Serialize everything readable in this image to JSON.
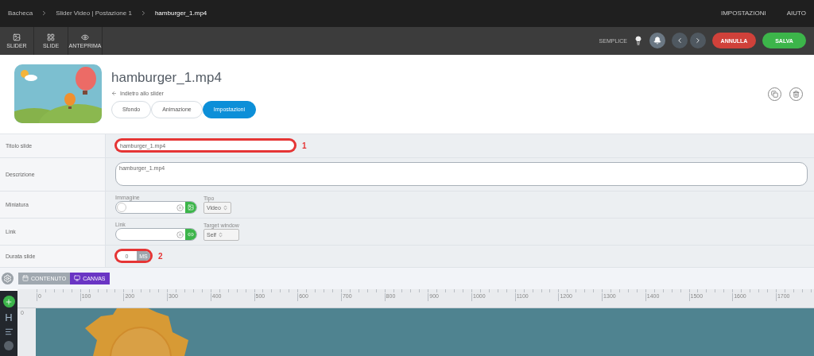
{
  "breadcrumb": [
    {
      "label": "Bacheca",
      "selected": false
    },
    {
      "label": "Slider Video | Postazione 1",
      "selected": false
    },
    {
      "label": "hamburger_1.mp4",
      "selected": true
    }
  ],
  "top_menu": [
    "IMPOSTAZIONI",
    "AIUTO"
  ],
  "tools": [
    {
      "kind": "image",
      "label": "SLIDER"
    },
    {
      "kind": "grid",
      "label": "SLIDE"
    },
    {
      "kind": "eye",
      "label": "ANTEPRIMA"
    }
  ],
  "mode_label": "SEMPLICE",
  "cancel_button": "ANNULLA",
  "save_button": "SALVA",
  "header": {
    "title": "hamburger_1.mp4",
    "back_link": "Indietro allo slider",
    "tabs": [
      {
        "label": "Sfondo",
        "selected": false
      },
      {
        "label": "Animazione",
        "selected": false
      },
      {
        "label": "Impostazioni",
        "selected": true
      }
    ]
  },
  "form": [
    {
      "kind": "text",
      "label": "Titolo slide",
      "value": "hamburger_1.mp4",
      "highlighted": true,
      "annotation": "1"
    },
    {
      "kind": "textarea",
      "label": "Descrizione",
      "value": "hamburger_1.mp4",
      "highlighted": false
    },
    {
      "kind": "media",
      "label": "Miniatura",
      "field_label": "Immagine",
      "select_label": "Tipo",
      "select_value": "Video"
    },
    {
      "kind": "link",
      "label": "Link",
      "field_label": "Link",
      "select_label": "Target window",
      "select_value": "Self"
    },
    {
      "kind": "duration",
      "label": "Durata slide",
      "value": "0",
      "unit": "MS",
      "highlighted": true,
      "annotation": "2"
    }
  ],
  "editor_tabs": [
    {
      "kind": "content",
      "label": "CONTENUTO",
      "selected": false
    },
    {
      "kind": "canvas",
      "label": "CANVAS",
      "selected": true
    }
  ],
  "ruler": [
    "0",
    "100",
    "200",
    "300",
    "400",
    "500",
    "600",
    "700",
    "800",
    "900",
    "1000",
    "1100",
    "1200",
    "1300",
    "1400",
    "1500",
    "1600",
    "1700"
  ],
  "ruler_side": "0",
  "side_tools": [
    {
      "kind": "add"
    },
    {
      "kind": "heading",
      "label": "H"
    },
    {
      "kind": "text"
    },
    {
      "kind": "circle"
    }
  ]
}
